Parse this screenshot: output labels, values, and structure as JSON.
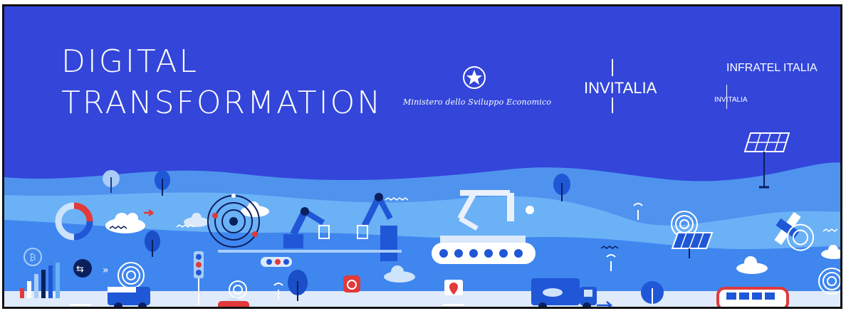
{
  "banner": {
    "title_line1": "DIGITAL",
    "title_line2": "TRANSFORMATION",
    "ministry_text": "Ministero dello Sviluppo Economico",
    "invitalia": "INVITALIA",
    "infratel": "INFRATEL ITALIA",
    "infratel_sub": "INVITALIA"
  },
  "colors": {
    "sky": "#3346d9",
    "wave_light": "#5aa0f2",
    "wave_mid": "#3f86ef",
    "ground": "#e9f0fb",
    "accent_red": "#e03a3a",
    "white": "#ffffff"
  },
  "icons": [
    "emblem-icon",
    "solar-panel-icon",
    "tree-icon",
    "robot-arm-icon",
    "conveyor-belt-icon",
    "cloud-icon",
    "donut-chart-icon",
    "bitcoin-icon",
    "wifi-signal-icon",
    "satellite-icon",
    "truck-icon",
    "bus-icon",
    "traffic-light-icon",
    "map-pin-icon",
    "gear-icon",
    "power-button-icon",
    "bar-chart-icon",
    "sync-icon",
    "orbit-icon"
  ]
}
